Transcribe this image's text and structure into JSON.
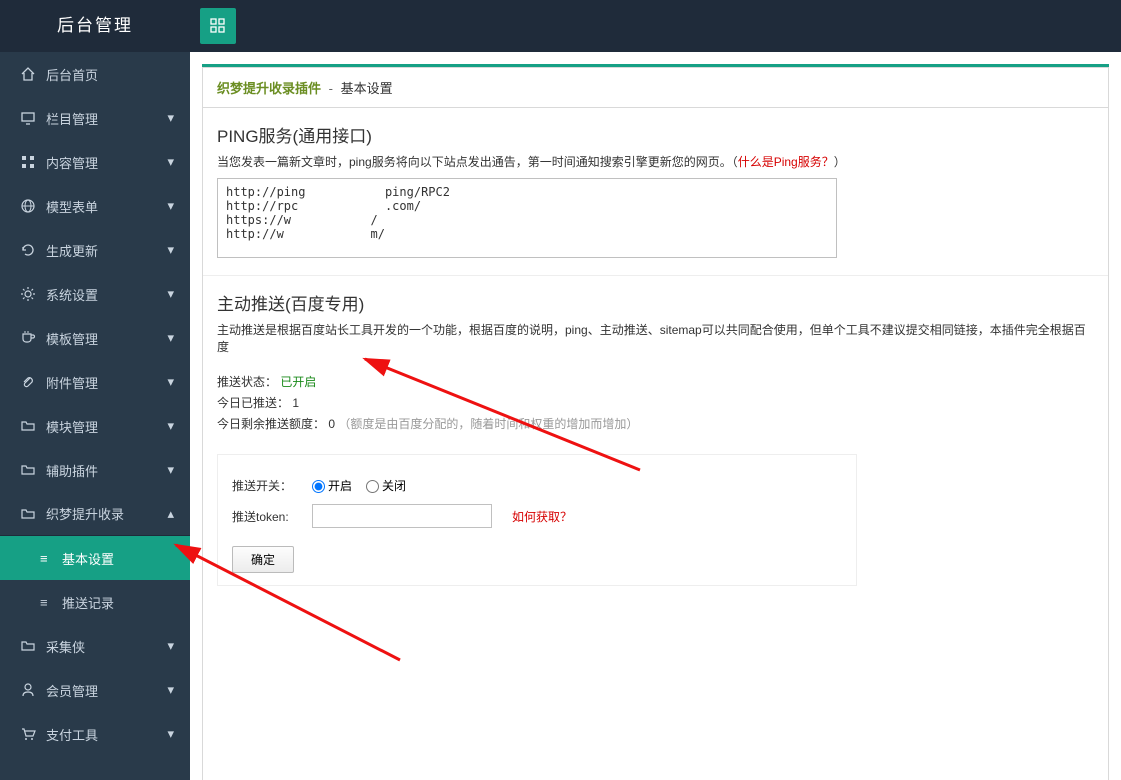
{
  "topbar": {
    "title": "后台管理"
  },
  "sidebar": {
    "items": [
      {
        "label": "后台首页",
        "icon": "home"
      },
      {
        "label": "栏目管理",
        "icon": "monitor"
      },
      {
        "label": "内容管理",
        "icon": "grid4"
      },
      {
        "label": "模型表单",
        "icon": "globe"
      },
      {
        "label": "生成更新",
        "icon": "refresh"
      },
      {
        "label": "系统设置",
        "icon": "gear"
      },
      {
        "label": "模板管理",
        "icon": "cup"
      },
      {
        "label": "附件管理",
        "icon": "clip"
      },
      {
        "label": "模块管理",
        "icon": "folder"
      },
      {
        "label": "辅助插件",
        "icon": "folder"
      },
      {
        "label": "织梦提升收录",
        "icon": "folder"
      },
      {
        "label": "采集侠",
        "icon": "folder"
      },
      {
        "label": "会员管理",
        "icon": "user"
      },
      {
        "label": "支付工具",
        "icon": "cart"
      }
    ],
    "sub": {
      "basic": "基本设置",
      "log": "推送记录"
    }
  },
  "crumb": {
    "plugin": "织梦提升收录插件",
    "sep": "-",
    "current": "基本设置"
  },
  "ping": {
    "title": "PING服务(通用接口)",
    "desc_pre": "当您发表一篇新文章时，ping服务将向以下站点发出通告，第一时间通知搜索引擎更新您的网页。（",
    "desc_link": "什么是Ping服务？",
    "desc_post": "）",
    "urls": "http://ping           ping/RPC2\nhttp://rpc            .com/\nhttps://w           /\nhttp://w            m/"
  },
  "push": {
    "title": "主动推送(百度专用)",
    "desc": "主动推送是根据百度站长工具开发的一个功能，根据百度的说明，ping、主动推送、sitemap可以共同配合使用，但单个工具不建议提交相同链接，本插件完全根据百度",
    "status_label": "推送状态：",
    "status_value": "已开启",
    "today_label": "今日已推送：",
    "today_value": "1",
    "remain_label": "今日剩余推送额度：",
    "remain_value": "0",
    "remain_note": "（额度是由百度分配的，随着时间和权重的增加而增加）",
    "switch_label": "推送开关：",
    "switch_on": "开启",
    "switch_off": "关闭",
    "token_label": "推送token:",
    "token_help": "如何获取？",
    "confirm": "确定"
  }
}
